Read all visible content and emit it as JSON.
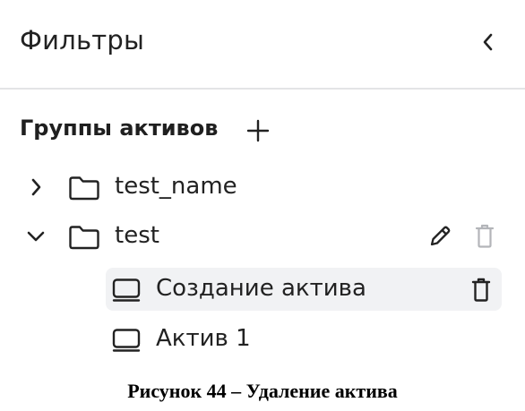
{
  "header": {
    "title": "Фильтры",
    "collapse_icon": "chevron-left-icon"
  },
  "groups_section": {
    "title": "Группы активов",
    "add_icon": "plus-icon",
    "groups": [
      {
        "label": "test_name",
        "expanded": false,
        "chevron_icon": "chevron-right-icon",
        "icon": "folder-icon"
      },
      {
        "label": "test",
        "expanded": true,
        "chevron_icon": "chevron-down-icon",
        "icon": "folder-icon",
        "actions": [
          "pencil-icon",
          "trash-icon"
        ],
        "assets": [
          {
            "label": "Создание актива",
            "icon": "monitor-icon",
            "selected": true,
            "actions": [
              "trash-icon"
            ]
          },
          {
            "label": "Актив 1",
            "icon": "monitor-icon",
            "selected": false
          }
        ]
      }
    ]
  },
  "caption": "Рисунок 44 – Удаление актива",
  "colors": {
    "text": "#222222",
    "divider": "#e3e4e6",
    "selected_row_bg": "#f1f2f4",
    "disabled_icon": "#b3b5b9"
  }
}
